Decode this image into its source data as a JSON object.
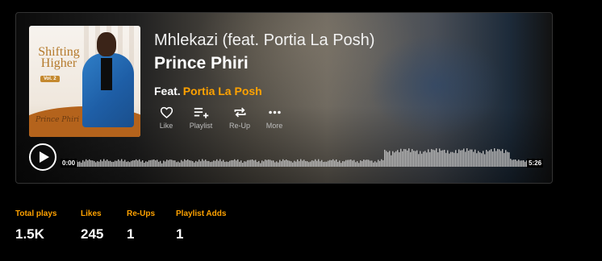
{
  "track": {
    "title": "Mhlekazi (feat. Portia La Posh)",
    "artist": "Prince Phiri",
    "feat_label": "Feat.",
    "feat_artist": "Portia La Posh"
  },
  "cover": {
    "title": "Shifting Higher",
    "volume": "Vol. 2",
    "artist_script": "Prince Phiri"
  },
  "actions": [
    {
      "label": "Like",
      "icon": "heart-icon"
    },
    {
      "label": "Playlist",
      "icon": "playlist-add-icon"
    },
    {
      "label": "Re-Up",
      "icon": "repost-icon"
    },
    {
      "label": "More",
      "icon": "more-dots-icon"
    }
  ],
  "player": {
    "current_time": "0:00",
    "duration": "5:26",
    "played_fraction": 0
  },
  "stats": [
    {
      "label": "Total plays",
      "value": "1.5K"
    },
    {
      "label": "Likes",
      "value": "245"
    },
    {
      "label": "Re-Ups",
      "value": "1"
    },
    {
      "label": "Playlist Adds",
      "value": "1"
    }
  ],
  "colors": {
    "accent": "#ffa200",
    "waveform": "#bdbdbd"
  }
}
